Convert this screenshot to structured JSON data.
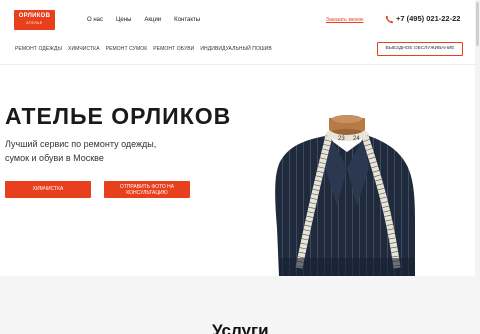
{
  "logo": {
    "name": "ОРЛИКОВ",
    "tagline": "АТЕЛЬЕ"
  },
  "topnav": [
    "О нас",
    "Цены",
    "Акции",
    "Контакты"
  ],
  "header": {
    "callback": "Заказать звонок",
    "phone": "+7 (495) 021-22-22"
  },
  "subnav": [
    "РЕМОНТ ОДЕЖДЫ",
    "ХИМЧИСТКА",
    "РЕМОНТ СУМОК",
    "РЕМОНТ ОБУВИ",
    "ИНДИВИДУАЛЬНЫЙ ПОШИВ"
  ],
  "express_button": "ВЫЕЗДНОЕ ОБСЛУЖИВАНИЕ",
  "hero": {
    "title": "АТЕЛЬЕ ОРЛИКОВ",
    "subtitle": "Лучший сервис по ремонту одежды, сумок и обуви в Москве",
    "button1": "ХИМЧИСТКА",
    "button2": "ОТПРАВИТЬ ФОТО НА КОНСУЛЬТАЦИЮ"
  },
  "section_title": "Услуги",
  "colors": {
    "accent": "#e8401c",
    "fabric": "#1f2a3d",
    "tape": "#e9e4d8"
  }
}
